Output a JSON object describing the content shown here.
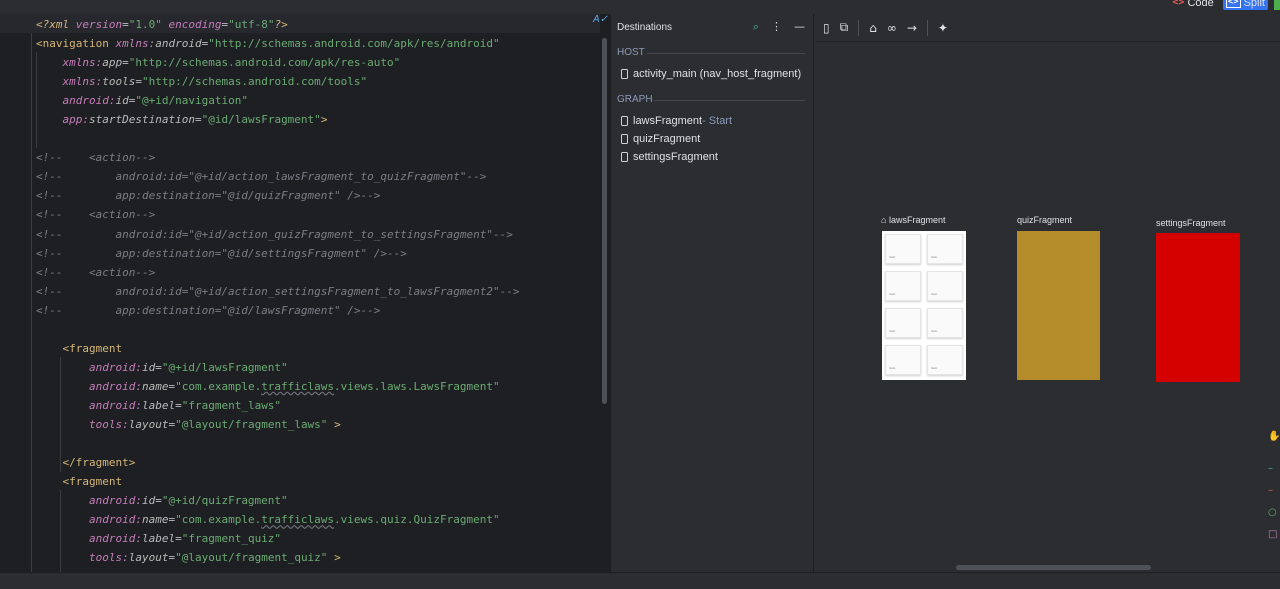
{
  "view_modes": {
    "code": "Code",
    "split": "Split"
  },
  "editor": {
    "lines": [
      [
        [
          "pi",
          "<?xml "
        ],
        [
          "ns",
          "version"
        ],
        [
          "plain",
          "="
        ],
        [
          "str",
          "\"1.0\""
        ],
        [
          "plain",
          " "
        ],
        [
          "ns",
          "encoding"
        ],
        [
          "plain",
          "="
        ],
        [
          "str",
          "\"utf-8\""
        ],
        [
          "pi",
          "?>"
        ]
      ],
      [
        [
          "tag",
          "<navigation "
        ],
        [
          "ns",
          "xmlns:"
        ],
        [
          "at",
          "android"
        ],
        [
          "plain",
          "="
        ],
        [
          "str",
          "\"http://schemas.android.com/apk/res/android\""
        ]
      ],
      [
        [
          "plain",
          "    "
        ],
        [
          "ns",
          "xmlns:"
        ],
        [
          "at",
          "app"
        ],
        [
          "plain",
          "="
        ],
        [
          "str",
          "\"http://schemas.android.com/apk/res-auto\""
        ]
      ],
      [
        [
          "plain",
          "    "
        ],
        [
          "ns",
          "xmlns:"
        ],
        [
          "at",
          "tools"
        ],
        [
          "plain",
          "="
        ],
        [
          "str",
          "\"http://schemas.android.com/tools\""
        ]
      ],
      [
        [
          "plain",
          "    "
        ],
        [
          "ns",
          "android:"
        ],
        [
          "at",
          "id"
        ],
        [
          "plain",
          "="
        ],
        [
          "str",
          "\"@+id/navigation\""
        ]
      ],
      [
        [
          "plain",
          "    "
        ],
        [
          "ns",
          "app:"
        ],
        [
          "at",
          "startDestination"
        ],
        [
          "plain",
          "="
        ],
        [
          "str",
          "\"@id/lawsFragment\""
        ],
        [
          "tag",
          ">"
        ]
      ],
      [
        [
          "plain",
          ""
        ]
      ],
      [
        [
          "cm",
          "<!--    <action-->"
        ]
      ],
      [
        [
          "cm",
          "<!--        android:id=\"@+id/action_lawsFragment_to_quizFragment\"-->"
        ]
      ],
      [
        [
          "cm",
          "<!--        app:destination=\"@id/quizFragment\" />-->"
        ]
      ],
      [
        [
          "cm",
          "<!--    <action-->"
        ]
      ],
      [
        [
          "cm",
          "<!--        android:id=\"@+id/action_quizFragment_to_settingsFragment\"-->"
        ]
      ],
      [
        [
          "cm",
          "<!--        app:destination=\"@id/settingsFragment\" />-->"
        ]
      ],
      [
        [
          "cm",
          "<!--    <action-->"
        ]
      ],
      [
        [
          "cm",
          "<!--        android:id=\"@+id/action_settingsFragment_to_lawsFragment2\"-->"
        ]
      ],
      [
        [
          "cm",
          "<!--        app:destination=\"@id/lawsFragment\" />-->"
        ]
      ],
      [
        [
          "plain",
          ""
        ]
      ],
      [
        [
          "plain",
          "    "
        ],
        [
          "tag",
          "<fragment"
        ]
      ],
      [
        [
          "plain",
          "        "
        ],
        [
          "ns",
          "android:"
        ],
        [
          "at",
          "id"
        ],
        [
          "plain",
          "="
        ],
        [
          "str",
          "\"@+id/lawsFragment\""
        ]
      ],
      [
        [
          "plain",
          "        "
        ],
        [
          "ns",
          "android:"
        ],
        [
          "at",
          "name"
        ],
        [
          "plain",
          "="
        ],
        [
          "str",
          "\"com.example."
        ],
        [
          "strU",
          "trafficlaws"
        ],
        [
          "str",
          ".views.laws.LawsFragment\""
        ]
      ],
      [
        [
          "plain",
          "        "
        ],
        [
          "ns",
          "android:"
        ],
        [
          "at",
          "label"
        ],
        [
          "plain",
          "="
        ],
        [
          "str",
          "\"fragment_laws\""
        ]
      ],
      [
        [
          "plain",
          "        "
        ],
        [
          "ns",
          "tools:"
        ],
        [
          "at",
          "layout"
        ],
        [
          "plain",
          "="
        ],
        [
          "str",
          "\"@layout/fragment_laws\""
        ],
        [
          "plain",
          " "
        ],
        [
          "tag",
          ">"
        ]
      ],
      [
        [
          "plain",
          ""
        ]
      ],
      [
        [
          "plain",
          "    "
        ],
        [
          "tag",
          "</fragment>"
        ]
      ],
      [
        [
          "plain",
          "    "
        ],
        [
          "tag",
          "<fragment"
        ]
      ],
      [
        [
          "plain",
          "        "
        ],
        [
          "ns",
          "android:"
        ],
        [
          "at",
          "id"
        ],
        [
          "plain",
          "="
        ],
        [
          "str",
          "\"@+id/quizFragment\""
        ]
      ],
      [
        [
          "plain",
          "        "
        ],
        [
          "ns",
          "android:"
        ],
        [
          "at",
          "name"
        ],
        [
          "plain",
          "="
        ],
        [
          "str",
          "\"com.example."
        ],
        [
          "strU",
          "trafficlaws"
        ],
        [
          "str",
          ".views.quiz.QuizFragment\""
        ]
      ],
      [
        [
          "plain",
          "        "
        ],
        [
          "ns",
          "android:"
        ],
        [
          "at",
          "label"
        ],
        [
          "plain",
          "="
        ],
        [
          "str",
          "\"fragment_quiz\""
        ]
      ],
      [
        [
          "plain",
          "        "
        ],
        [
          "ns",
          "tools:"
        ],
        [
          "at",
          "layout"
        ],
        [
          "plain",
          "="
        ],
        [
          "str",
          "\"@layout/fragment_quiz\""
        ],
        [
          "plain",
          " "
        ],
        [
          "tag",
          ">"
        ]
      ]
    ]
  },
  "destinations": {
    "title": "Destinations",
    "host_section": "HOST",
    "host_item": "activity_main (nav_host_fragment)",
    "graph_section": "GRAPH",
    "graph_items": [
      {
        "name": "lawsFragment",
        "suffix": " - Start"
      },
      {
        "name": "quizFragment",
        "suffix": ""
      },
      {
        "name": "settingsFragment",
        "suffix": ""
      }
    ]
  },
  "canvas": {
    "fragments": [
      {
        "label": "lawsFragment",
        "start": true,
        "preview": "list",
        "color": "#ffffff"
      },
      {
        "label": "quizFragment",
        "start": false,
        "preview": "solid",
        "color": "#b48d2a"
      },
      {
        "label": "settingsFragment",
        "start": false,
        "preview": "solid",
        "color": "#d50000"
      }
    ],
    "mini_card_text": "hello"
  },
  "icons": {
    "search": "search-icon",
    "more": "more-vertical-icon",
    "collapse": "minus-icon",
    "new_destination": "new-destination-icon",
    "nested_graph": "nested-graph-icon",
    "start_destination": "home-icon",
    "deep_link": "link-icon",
    "action": "arrow-right-icon",
    "auto_arrange": "sparkle-icon"
  }
}
